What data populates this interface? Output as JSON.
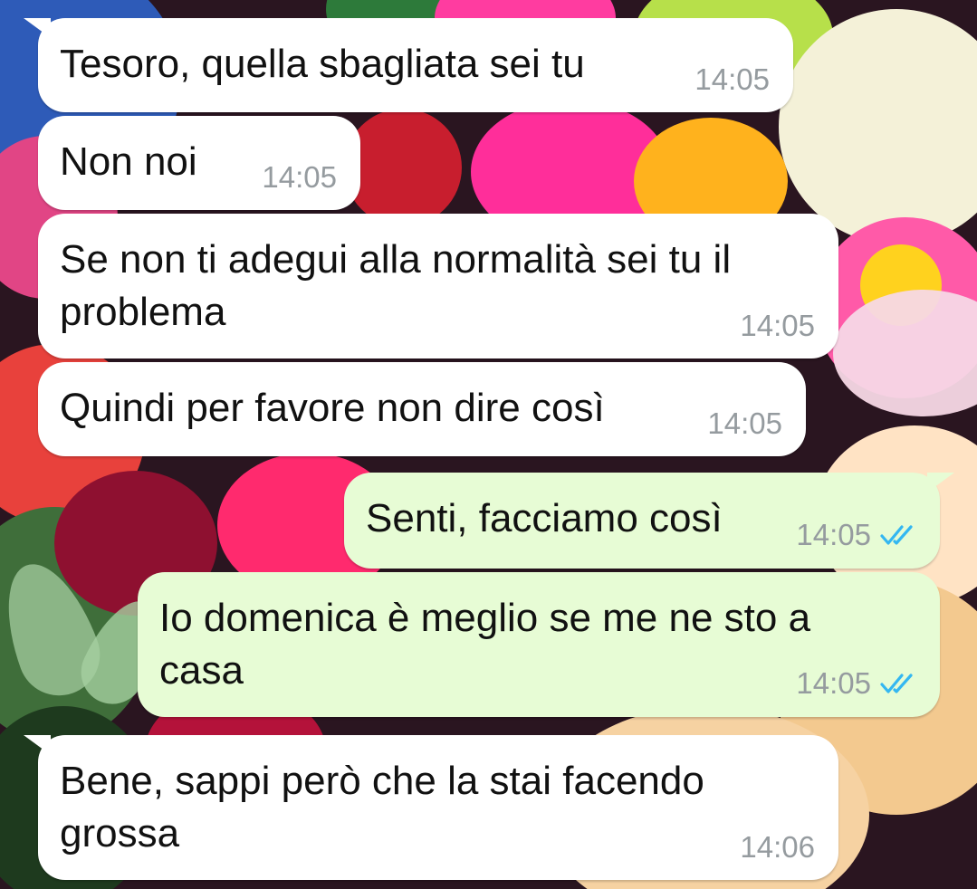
{
  "conversation": {
    "messages": [
      {
        "direction": "incoming",
        "lines": [
          "Tesoro, quella sbagliata sei tu"
        ],
        "time": "14:05"
      },
      {
        "direction": "incoming",
        "lines": [
          "Non noi"
        ],
        "time": "14:05"
      },
      {
        "direction": "incoming",
        "lines": [
          "Se non ti adegui alla normalità sei tu il",
          "problema"
        ],
        "time": "14:05"
      },
      {
        "direction": "incoming",
        "lines": [
          "Quindi per favore non dire così"
        ],
        "time": "14:05"
      },
      {
        "direction": "outgoing",
        "lines": [
          "Senti, facciamo così"
        ],
        "time": "14:05",
        "status_icon": "double-check-read-icon"
      },
      {
        "direction": "outgoing",
        "lines": [
          "Io domenica è meglio se me ne sto a",
          "casa"
        ],
        "time": "14:05",
        "status_icon": "double-check-read-icon"
      },
      {
        "direction": "incoming",
        "lines": [
          "Bene, sappi però che la stai facendo",
          "grossa"
        ],
        "time": "14:06"
      }
    ]
  },
  "theme": {
    "incoming_bubble": "#ffffff",
    "outgoing_bubble": "#e7fcd5",
    "timestamp_color": "#959b9f",
    "read_tick_color": "#34b7f1",
    "wallpaper": "flowers bouquet photo"
  }
}
